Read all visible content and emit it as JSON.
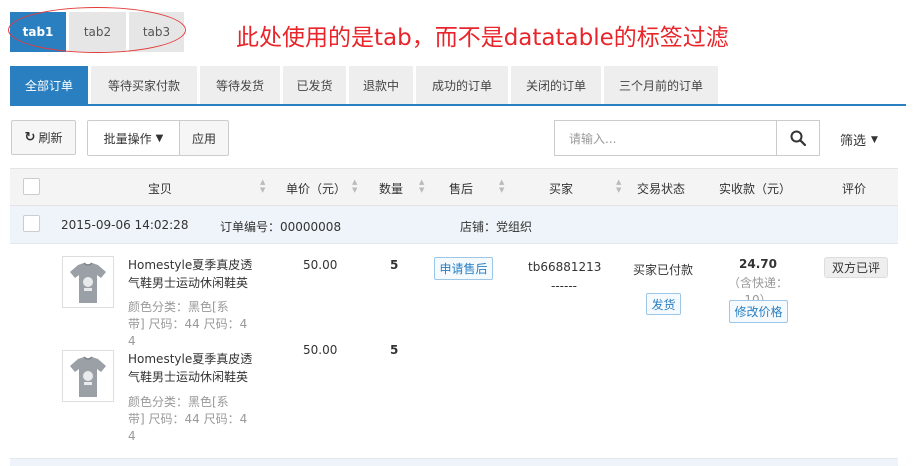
{
  "top_tabs": [
    {
      "label": "tab1",
      "active": true
    },
    {
      "label": "tab2",
      "active": false
    },
    {
      "label": "tab3",
      "active": false
    }
  ],
  "annotation_text": "此处使用的是tab，而不是datatable的标签过滤",
  "status_tabs": [
    {
      "label": "全部订单",
      "active": true
    },
    {
      "label": "等待买家付款",
      "active": false
    },
    {
      "label": "等待发货",
      "active": false
    },
    {
      "label": "已发货",
      "active": false
    },
    {
      "label": "退款中",
      "active": false
    },
    {
      "label": "成功的订单",
      "active": false
    },
    {
      "label": "关闭的订单",
      "active": false
    },
    {
      "label": "三个月前的订单",
      "active": false
    }
  ],
  "toolbar": {
    "refresh_label": "刷新",
    "batch_label": "批量操作",
    "apply_label": "应用",
    "search_placeholder": "请输入...",
    "filter_label": "筛选"
  },
  "table": {
    "headers": [
      "宝贝",
      "单价（元）",
      "数量",
      "售后",
      "买家",
      "交易状态",
      "实收款（元）",
      "评价"
    ]
  },
  "order": {
    "datetime": "2015-09-06 14:02:28",
    "order_no_label": "订单编号：00000008",
    "shop_label": "店铺：党组织",
    "items": [
      {
        "title_lines": [
          "Homestyle夏季真皮透",
          "气鞋男士运动休闲鞋英"
        ],
        "sku_lines": [
          "颜色分类：黑色[系",
          "带]  尺码：44  尺码：4",
          "4"
        ],
        "price": "50.00",
        "qty": "5"
      },
      {
        "title_lines": [
          "Homestyle夏季真皮透",
          "气鞋男士运动休闲鞋英"
        ],
        "sku_lines": [
          "颜色分类：黑色[系",
          "带]  尺码：44  尺码：4",
          "4"
        ],
        "price": "50.00",
        "qty": "5"
      }
    ],
    "after_sale_label": "申请售后",
    "buyer": "tb66881213",
    "buyer_extra": "------",
    "status": "买家已付款",
    "ship_label": "发货",
    "amount": "24.70",
    "shipping_note": "（含快递：10）",
    "modify_price_label": "修改价格",
    "evaluation": "双方已评"
  },
  "colors": {
    "primary": "#2a7fc1",
    "annotation": "#e8252a",
    "meta_bg": "#eef4f9"
  }
}
